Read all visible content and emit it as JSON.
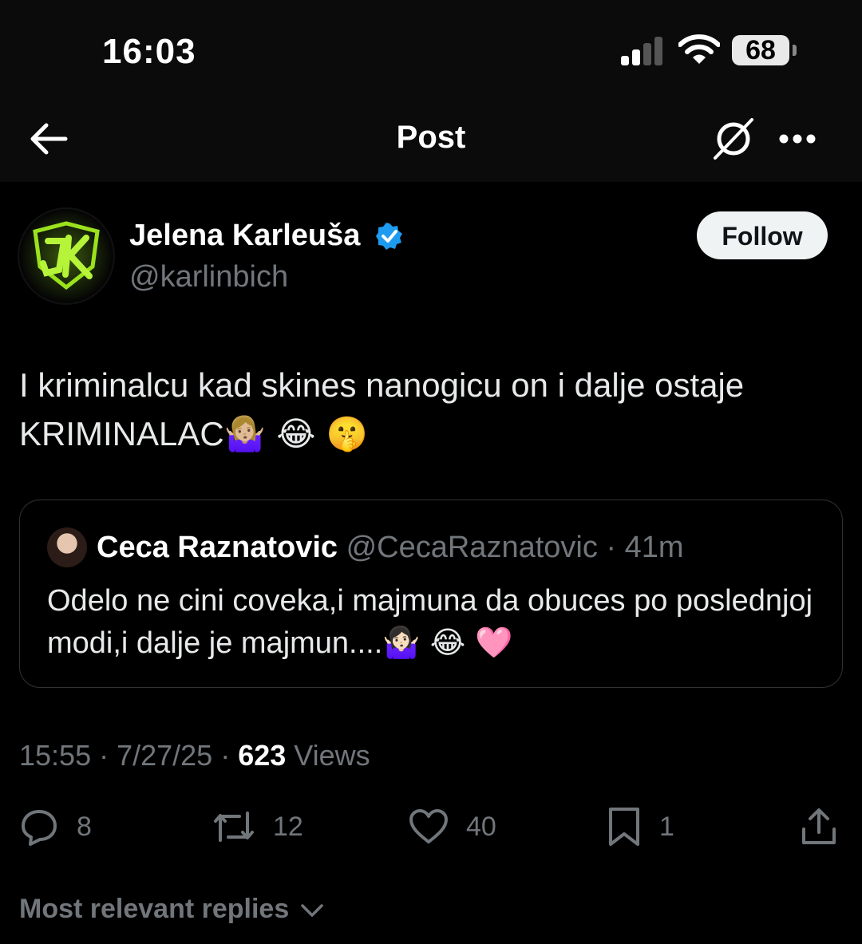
{
  "status_bar": {
    "time": "16:03",
    "battery": "68"
  },
  "nav": {
    "title": "Post"
  },
  "post": {
    "author_name": "Jelena Karleuša",
    "handle": "@karlinbich",
    "follow_label": "Follow",
    "text": "I kriminalcu kad skines nanogicu on i dalje ostaje KRIMINALAC",
    "text_emojis": "🤷🏼‍♀️ 😂 🤫",
    "quoted": {
      "author_name": "Ceca Raznatovic",
      "meta": "@CecaRaznatovic · 41m",
      "text": "Odelo ne cini coveka,i majmuna da obuces po poslednjoj modi,i dalje je majmun....",
      "text_emojis": "🤷🏻‍♀️ 😂 🩷"
    },
    "timestamp": "15:55 · 7/27/25 · ",
    "views_count": "623",
    "views_label": " Views"
  },
  "actions": {
    "replies": "8",
    "reposts": "12",
    "likes": "40",
    "bookmarks": "1"
  },
  "replies_sort_label": "Most relevant replies",
  "colors": {
    "background": "#000000",
    "muted": "#71767b",
    "verified": "#1d9bf0",
    "text": "#e7e9ea",
    "logo_green": "#9be21d"
  },
  "icons": [
    "back-arrow-icon",
    "grok-icon",
    "more-icon",
    "verified-badge-icon",
    "reply-icon",
    "repost-icon",
    "like-icon",
    "bookmark-icon",
    "share-icon",
    "chevron-down-icon"
  ]
}
